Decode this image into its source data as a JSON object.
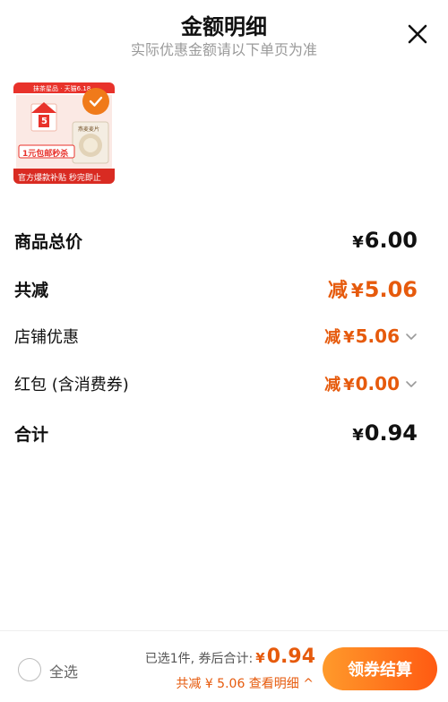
{
  "header": {
    "title": "金额明细",
    "subtitle": "实际优惠金额请以下单页为准"
  },
  "product": {
    "image_top_banner": "抹茶星品 · 天猫6.18",
    "image_tag_price": "5",
    "image_promo": "1元包邮秒杀",
    "image_footer": "官方爆款补贴 秒完即止",
    "image_product_label": "燕麦麦片"
  },
  "rows": [
    {
      "label": "商品总价",
      "prefix": "",
      "symbol": "¥",
      "amount": "6.00"
    },
    {
      "label": "共减",
      "prefix": "减",
      "symbol": "¥",
      "amount": "5.06"
    },
    {
      "label": "店铺优惠",
      "prefix": "减",
      "symbol": "¥",
      "amount": "5.06"
    },
    {
      "label": "红包 (含消费券)",
      "prefix": "减",
      "symbol": "¥",
      "amount": "0.00"
    },
    {
      "label": "合计",
      "prefix": "",
      "symbol": "¥",
      "amount": "0.94"
    }
  ],
  "bottom": {
    "select_all": "全选",
    "selected_text": "已选1件, 券后合计:",
    "total_symbol": "¥",
    "total_amount": "0.94",
    "discount_detail": "共减 ¥ 5.06 查看明细 ^",
    "checkout": "领券结算"
  },
  "colors": {
    "accent": "#e65a0c",
    "checkout_start": "#ff9a2b",
    "checkout_end": "#ff5a12"
  }
}
